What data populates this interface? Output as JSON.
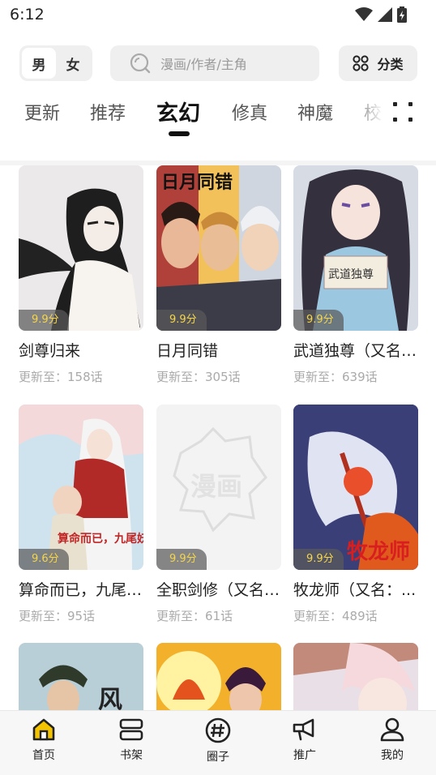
{
  "status_bar": {
    "time": "6:12"
  },
  "header": {
    "gender": {
      "male": "男",
      "female": "女",
      "selected": "男"
    },
    "search": {
      "placeholder": "漫画/作者/主角",
      "icon": "search-icon"
    },
    "category": {
      "label": "分类",
      "icon": "grid-icon"
    }
  },
  "tabs": [
    {
      "label": "更新"
    },
    {
      "label": "推荐"
    },
    {
      "label": "玄幻",
      "active": true
    },
    {
      "label": "修真"
    },
    {
      "label": "神魔"
    },
    {
      "label": "校"
    }
  ],
  "comics": [
    {
      "title": "剑尊归来",
      "score": "9.9分",
      "update": "更新至：158话"
    },
    {
      "title": "日月同错",
      "score": "9.9分",
      "update": "更新至：305话",
      "cover_text": "日月同错"
    },
    {
      "title": "武道独尊（又名：...",
      "score": "9.9分",
      "update": "更新至：639话",
      "cover_text": "武道独尊"
    },
    {
      "title": "算命而已，九尾妖帝...",
      "score": "9.6分",
      "update": "更新至：95话",
      "cover_text": "算命而已，九尾妖帝"
    },
    {
      "title": "全职剑修（又名：...",
      "score": "9.9分",
      "update": "更新至：61话",
      "cover_text": "漫画"
    },
    {
      "title": "牧龙师（又名：...",
      "score": "9.9分",
      "update": "更新至：489话",
      "cover_text": "牧龙师"
    },
    {
      "title": "",
      "score": "",
      "update": "",
      "cover_text": "风"
    },
    {
      "title": "",
      "score": "",
      "update": ""
    },
    {
      "title": "",
      "score": "",
      "update": ""
    }
  ],
  "bottom_nav": [
    {
      "label": "首页",
      "icon": "home-icon",
      "active": true,
      "accent": "#f5c400"
    },
    {
      "label": "书架",
      "icon": "bookshelf-icon"
    },
    {
      "label": "圈子",
      "icon": "hashtag-icon"
    },
    {
      "label": "推广",
      "icon": "megaphone-icon"
    },
    {
      "label": "我的",
      "icon": "user-icon"
    }
  ]
}
